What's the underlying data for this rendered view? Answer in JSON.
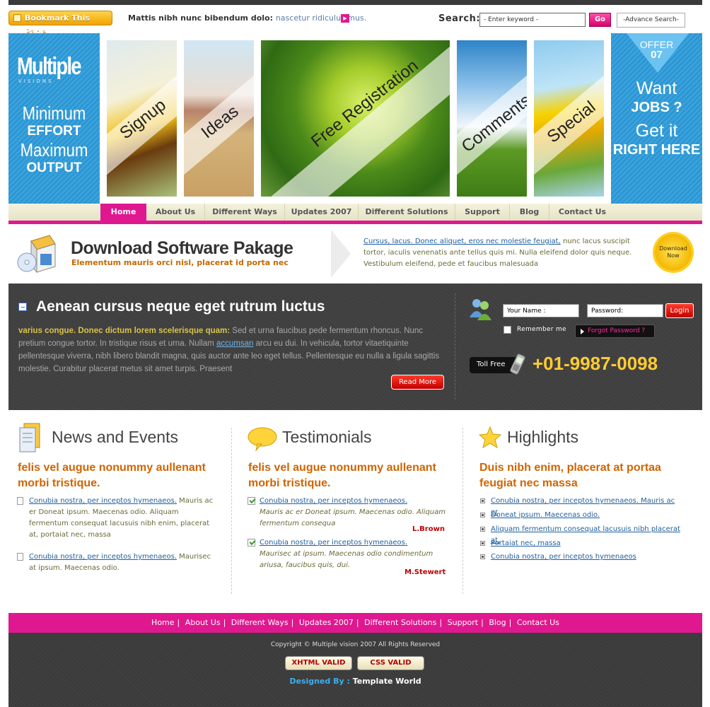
{
  "header": {
    "bookmark_label": "Bookmark This Page",
    "tagline_bold": "Mattis nibh nunc bibendum dolo:",
    "tagline_light": "nascetur ridiculus mus.",
    "search_label": "Search:",
    "search_placeholder": "- Enter keyword -",
    "go_label": "Go",
    "advance_label": "-Advance Search-"
  },
  "banner": {
    "brand": "Multiple",
    "brand_sub": "VISIONS",
    "slogan": [
      "Minimum",
      "EFFORT",
      "Maximum",
      "OUTPUT"
    ],
    "panels": [
      "Signup",
      "Ideas",
      "Free Registration",
      "Comments",
      "Special"
    ],
    "offer_label": "OFFER",
    "offer_number": "07",
    "offer_lines": [
      "Want",
      "JOBS ?",
      "Get it",
      "RIGHT HERE"
    ]
  },
  "nav": {
    "items": [
      "Home",
      "About Us",
      "Different Ways",
      "Updates 2007",
      "Different Solutions",
      "Support",
      "Blog",
      "Contact Us"
    ],
    "active": "Home"
  },
  "download": {
    "title": "Download Software Pakage",
    "subtitle": "Elementum mauris orci nisl, placerat id porta nec",
    "desc_link": "Cursus, lacus. Donec aliquet, eros nec molestie feugiat,",
    "desc_rest": " nunc lacus suscipit tortor, iaculis venenatis ante tellus quis mi. Nulla eleifend dolor quis neque. Vestibulum eleifend, pede et faucibus malesuada",
    "seal": "Download Now"
  },
  "feature": {
    "heading": "Aenean cursus neque eget rutrum luctus",
    "highlight": "varius congue. Donec dictum lorem scelerisque quam:",
    "text1": " Sed et urna faucibus pede fermentum rhoncus. Nunc pretium congue tortor. In tristique risus et urna. Nullam ",
    "link": "accumsan",
    "text2": " arcu eu dui. In vehicula, tortor vitaetiquinte pellentesque viverra, nibh libero blandit magna, quis auctor ante leo eget tellus. Pellentesque eu nulla a ligula sagittis molestie. Curabitur placerat metus sit amet turpis. Praesent",
    "read_more": "Read More"
  },
  "login": {
    "user_value": "Your Name :",
    "pass_value": "Password:",
    "login_label": "Login",
    "remember_label": "Remember me",
    "forgot_label": "Forgot Password ?",
    "tollfree_label": "Toll Free",
    "phone": "+01-9987-0098"
  },
  "news": {
    "title": "News and Events",
    "subtitle": "felis vel augue nonummy aullenant morbi tristique.",
    "items": [
      {
        "link": "Conubia nostra, per inceptos hymenaeos.",
        "text": " Mauris ac er Doneat ipsum. Maecenas odio. Aliquam fermentum consequat lacusuis nibh enim, placerat at, portaiat nec, massa"
      },
      {
        "link": "Conubia nostra, per inceptos hymenaeos.",
        "text": " Maurisec at ipsum. Maecenas odio."
      }
    ]
  },
  "testimonials": {
    "title": "Testimonials",
    "subtitle": "felis vel augue nonummy aullenant morbi tristique.",
    "items": [
      {
        "link": "Conubia nostra, per inceptos hymenaeos.",
        "text": "Mauris ac er Doneat ipsum. Maecenas odio. Aliquam fermentum consequa",
        "author": "L.Brown"
      },
      {
        "link": "Conubia nostra, per inceptos hymenaeos.",
        "text": "Maurisec at ipsum. Maecenas odio condimentum ariusa, faucibus quis, dui.",
        "author": "M.Stewert"
      }
    ]
  },
  "highlights": {
    "title": "Highlights",
    "subtitle": "Duis nibh enim, placerat at portaa feugiat nec massa",
    "items": [
      "Conubia nostra, per inceptos hymenaeos. Mauris ac er",
      "Doneat ipsum. Maecenas odio.",
      "Aliquam fermentum consequat lacusuis nibh  placerat at,",
      "Portaiat nec, massa",
      "Conubia nostra, per inceptos hymenaeos"
    ]
  },
  "footer": {
    "nav": [
      "Home",
      "About Us",
      "Different Ways",
      "Updates 2007",
      "Different Solutions",
      "Support",
      "Blog",
      "Contact Us"
    ],
    "separator": "|",
    "copyright": "Copyright © Multiple vision 2007 All Rights Reserved",
    "xhtml": "XHTML VALID",
    "css": "CSS VALID",
    "designed_label": "Designed By :",
    "designed_by": "Template World"
  },
  "colors": {
    "accent_pink": "#e0188f",
    "banner_blue": "#2a93d0",
    "orange_heading": "#d06400",
    "phone_yellow": "#ffcc33"
  }
}
